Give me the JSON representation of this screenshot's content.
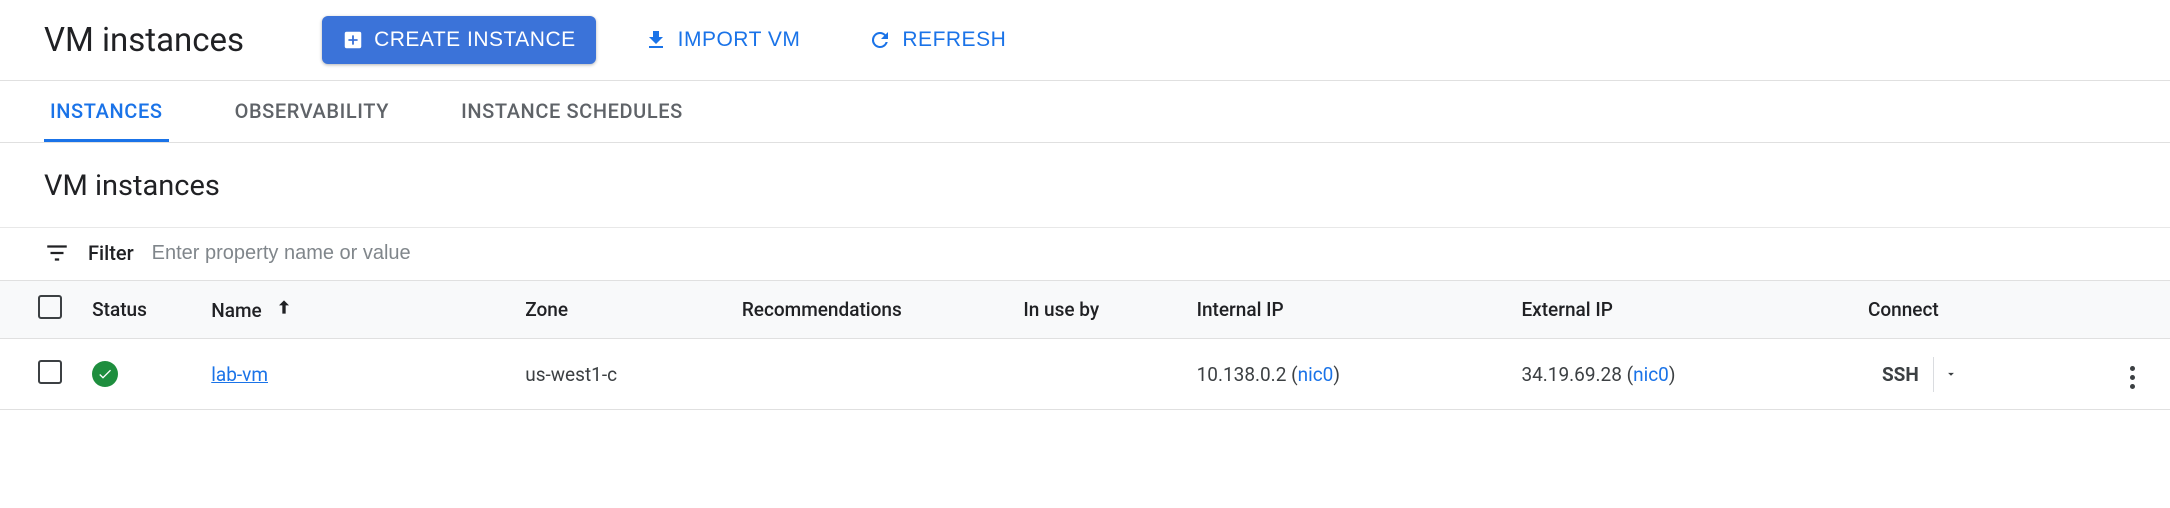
{
  "header": {
    "title": "VM instances",
    "create_label": "CREATE INSTANCE",
    "import_label": "IMPORT VM",
    "refresh_label": "REFRESH"
  },
  "tabs": [
    {
      "label": "INSTANCES",
      "active": true
    },
    {
      "label": "OBSERVABILITY",
      "active": false
    },
    {
      "label": "INSTANCE SCHEDULES",
      "active": false
    }
  ],
  "section_title": "VM instances",
  "filter": {
    "label": "Filter",
    "placeholder": "Enter property name or value",
    "value": ""
  },
  "columns": {
    "status": "Status",
    "name": "Name",
    "zone": "Zone",
    "recommendations": "Recommendations",
    "in_use_by": "In use by",
    "internal_ip": "Internal IP",
    "external_ip": "External IP",
    "connect": "Connect"
  },
  "rows": [
    {
      "status": "running",
      "name": "lab-vm",
      "zone": "us-west1-c",
      "recommendations": "",
      "in_use_by": "",
      "internal_ip": "10.138.0.2",
      "internal_nic": "nic0",
      "external_ip": "34.19.69.28",
      "external_nic": "nic0",
      "connect": "SSH"
    }
  ]
}
